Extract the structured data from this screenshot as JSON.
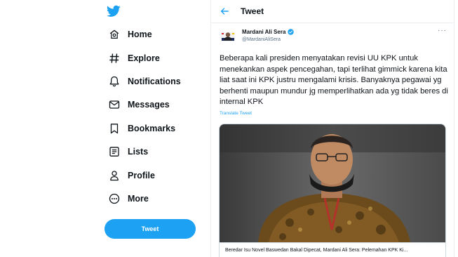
{
  "sidebar": {
    "logo_icon": "twitter-bird-icon",
    "brand_color": "#1da1f2",
    "items": [
      {
        "label": "Home",
        "icon": "home-icon"
      },
      {
        "label": "Explore",
        "icon": "hashtag-icon"
      },
      {
        "label": "Notifications",
        "icon": "bell-icon"
      },
      {
        "label": "Messages",
        "icon": "envelope-icon"
      },
      {
        "label": "Bookmarks",
        "icon": "bookmark-icon"
      },
      {
        "label": "Lists",
        "icon": "list-icon"
      },
      {
        "label": "Profile",
        "icon": "person-icon"
      },
      {
        "label": "More",
        "icon": "more-circle-icon"
      }
    ],
    "tweet_button": "Tweet"
  },
  "header": {
    "title": "Tweet",
    "back_icon": "back-arrow-icon"
  },
  "tweet": {
    "author_name": "Mardani Ali Sera",
    "author_handle": "@MardaniAliSera",
    "verified": true,
    "more": "···",
    "text": "Beberapa kali presiden menyatakan revisi UU KPK untuk menekankan aspek pencegahan, tapi terlihat gimmick karena kita liat saat ini KPK justru mengalami krisis. Banyaknya pegawai yg berhenti maupun mundur jg memperlihatkan ada yg tidak beres di internal KPK",
    "translate": "Translate Tweet",
    "card_caption": "Beredar Isu Novel Baswedan Bakal Dipecat, Mardani Ali Sera: Pelemahan KPK Ki..."
  }
}
